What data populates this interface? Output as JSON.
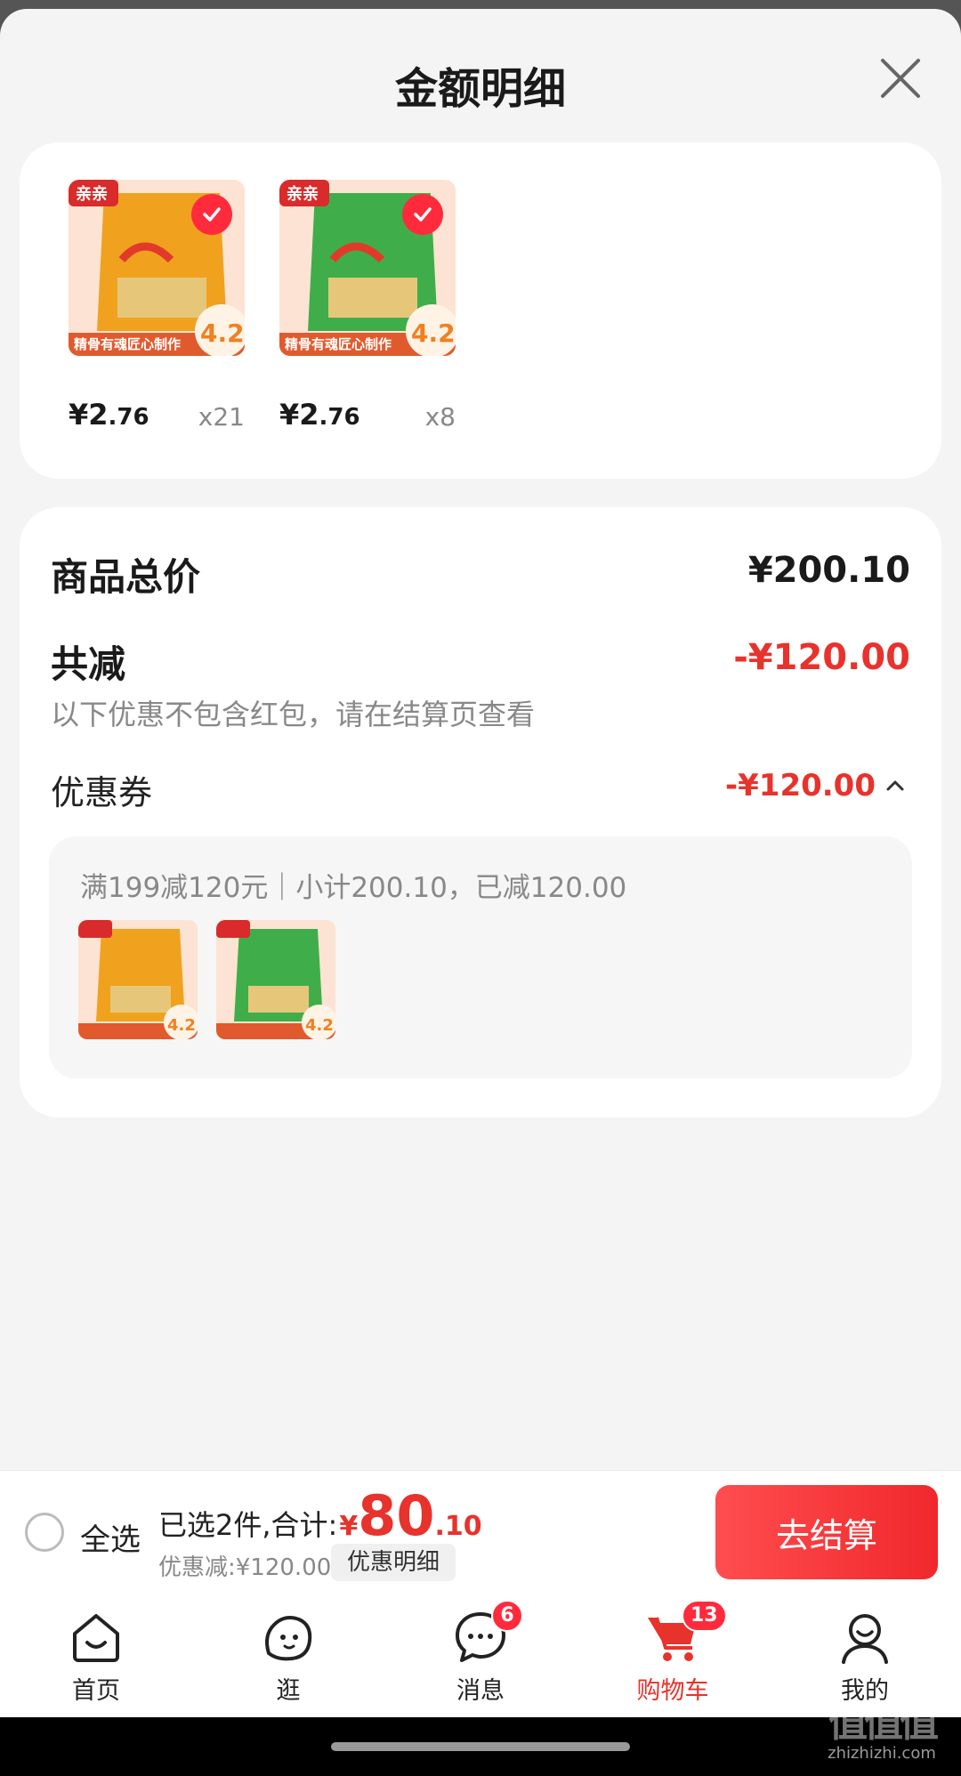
{
  "sheet": {
    "title": "金额明细",
    "close_icon": "close-icon"
  },
  "products": [
    {
      "price_int": "¥2",
      "price_dec": ".76",
      "qty": "x21",
      "thumb_badge": "4.2",
      "thumb_slogan": "精骨有魂匠心制作",
      "variant_color": "#f0a21f",
      "checked": true
    },
    {
      "price_int": "¥2",
      "price_dec": ".76",
      "qty": "x8",
      "thumb_badge": "4.2",
      "thumb_slogan": "精骨有魂匠心制作",
      "variant_color": "#3fae4a",
      "checked": true
    }
  ],
  "summary": {
    "total_label": "商品总价",
    "total_value": "¥200.10",
    "reduce_label": "共减",
    "reduce_value": "-¥120.00",
    "reduce_note": "以下优惠不包含红包，请在结算页查看",
    "coupon_label": "优惠券",
    "coupon_value": "-¥120.00",
    "coupon_desc": "满199减120元｜小计200.10，已减120.00"
  },
  "bottom_bar": {
    "select_all_label": "全选",
    "selected_text": "已选2件,合计:",
    "total_currency": "¥",
    "total_int": "80",
    "total_frac": ".10",
    "discount_text": "优惠减:¥120.00",
    "detail_chip": "优惠明细",
    "checkout_label": "去结算"
  },
  "tabs": [
    {
      "label": "首页",
      "icon": "home-icon",
      "badge": ""
    },
    {
      "label": "逛",
      "icon": "browse-icon",
      "badge": ""
    },
    {
      "label": "消息",
      "icon": "message-icon",
      "badge": "6"
    },
    {
      "label": "购物车",
      "icon": "cart-icon",
      "badge": "13",
      "active": true
    },
    {
      "label": "我的",
      "icon": "profile-icon",
      "badge": ""
    }
  ],
  "watermark": {
    "mark": "值值值",
    "site": "zhizhizhi.com"
  },
  "colors": {
    "accent_red": "#e8322c",
    "checkout_red": "#f0282c",
    "background": "#f4f4f4"
  }
}
